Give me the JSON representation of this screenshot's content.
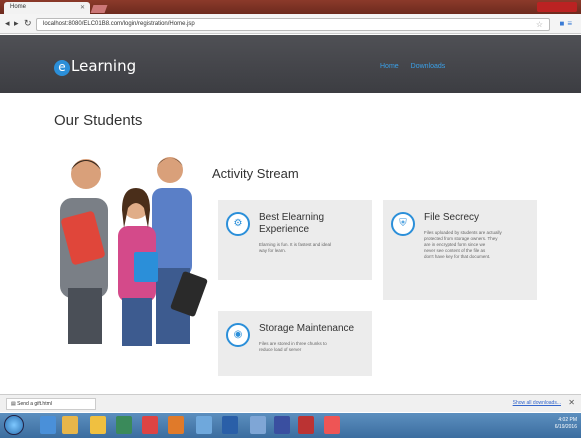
{
  "browser": {
    "tab_title": "Home",
    "url": "localhost:8080/ELC01B8.com/login/registration/Home.jsp"
  },
  "site": {
    "logo_letter": "e",
    "logo_text": "Learning",
    "nav": [
      "Home",
      "Downloads"
    ]
  },
  "page": {
    "students_heading": "Our Students",
    "activity_heading": "Activity Stream"
  },
  "cards": [
    {
      "icon": "gears-icon",
      "title_line1": "Best Elearning",
      "title_line2": "Experience",
      "desc": [
        "Elarning is fun. It is fastest and ideal",
        "way for learn."
      ]
    },
    {
      "icon": "shield-icon",
      "title_line1": "File Secrecy",
      "title_line2": "",
      "desc": [
        "Files uploaded by students are actually",
        "protected from storage owners. They",
        "are in encrypted form since we",
        "never see content of the file as",
        "don't have key for that document."
      ]
    },
    {
      "icon": "eye-icon",
      "title_line1": "Storage Maintenance",
      "title_line2": "",
      "desc": [
        "Files are stored in three chunks to",
        "reduce load of server"
      ]
    }
  ],
  "downloads": {
    "item": "Send a gift.html",
    "show_all": "Show all downloads..."
  },
  "taskbar": {
    "time": "4:02 PM",
    "date": "6/19/2016"
  },
  "colors": {
    "accent": "#2b8fd9",
    "header": "#46474c",
    "card": "#ececec"
  }
}
